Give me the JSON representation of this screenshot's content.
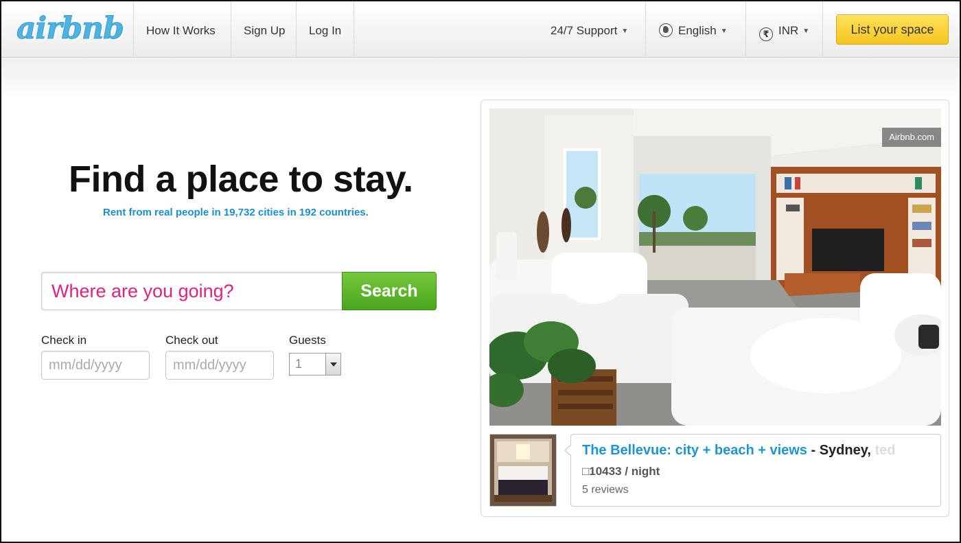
{
  "header": {
    "logo": "airbnb",
    "nav": [
      "How It Works",
      "Sign Up",
      "Log In"
    ],
    "support": "24/7 Support",
    "language": "English",
    "currency": "INR",
    "list_space": "List your space"
  },
  "hero": {
    "title": "Find a place to stay.",
    "subtitle": "Rent from real people in 19,732 cities in 192 countries."
  },
  "search": {
    "placeholder": "Where are you going?",
    "button": "Search"
  },
  "booking": {
    "checkin_label": "Check in",
    "checkin_placeholder": "mm/dd/yyyy",
    "checkout_label": "Check out",
    "checkout_placeholder": "mm/dd/yyyy",
    "guests_label": "Guests",
    "guests_value": "1"
  },
  "featured": {
    "watermark": "Airbnb.com",
    "listing_name": "The Bellevue: city + beach + views",
    "separator": " - ",
    "city": "Sydney,",
    "city_faded": " ted",
    "price": "□10433 / night",
    "reviews": "5 reviews"
  },
  "colors": {
    "brand_blue": "#1f94cf",
    "search_pink": "#e0227e",
    "search_green": "#5ab52b",
    "cta_yellow": "#f8cf33"
  }
}
